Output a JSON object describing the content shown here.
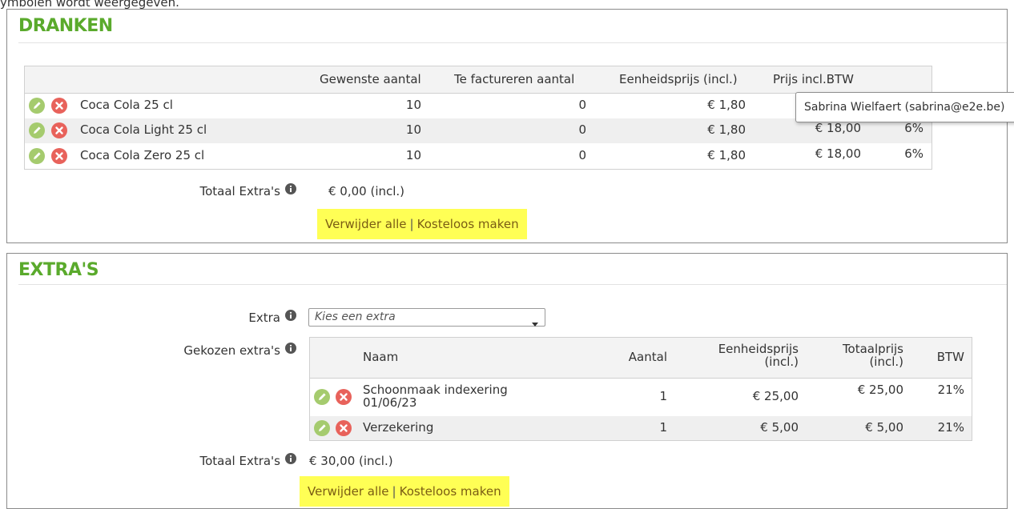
{
  "intro_text": "ymbolen wordt weergegeven.",
  "tooltip_text": "Sabrina Wielfaert (sabrina@e2e.be)",
  "colors": {
    "title_green": "#5aaa2c",
    "edit_icon": "#a5cb6e",
    "delete_icon": "#e8625b",
    "highlight": "#ffff55"
  },
  "icons": {
    "edit": "pencil-icon",
    "delete": "x-circle-icon",
    "info": "info-icon",
    "dropdown": "caret-down-icon"
  },
  "dranken": {
    "title": "DRANKEN",
    "columns": {
      "qty_wanted": "Gewenste aantal",
      "qty_invoice": "Te factureren aantal",
      "unit_price": "Eenheidsprijs (incl.)",
      "price": "Prijs incl.BTW"
    },
    "rows": [
      {
        "name": "Coca Cola 25 cl",
        "qty_wanted": "10",
        "qty_invoice": "0",
        "unit_price": "€ 1,80",
        "price": "",
        "vat": ""
      },
      {
        "name": "Coca Cola Light 25 cl",
        "qty_wanted": "10",
        "qty_invoice": "0",
        "unit_price": "€ 1,80",
        "price": "€ 18,00",
        "vat": "6%"
      },
      {
        "name": "Coca Cola Zero 25 cl",
        "qty_wanted": "10",
        "qty_invoice": "0",
        "unit_price": "€ 1,80",
        "price": "€ 18,00",
        "vat": "6%"
      }
    ],
    "total_label": "Totaal Extra's",
    "total_value": "€ 0,00 (incl.)",
    "remove_all": "Verwijder alle",
    "separator": "|",
    "make_free": "Kosteloos maken"
  },
  "extras": {
    "title": "EXTRA'S",
    "extra_label": "Extra",
    "select_placeholder": "Kies een extra",
    "chosen_label": "Gekozen extra's",
    "columns": {
      "name": "Naam",
      "qty": "Aantal",
      "unit_price_1": "Eenheidsprijs",
      "unit_price_2": "(incl.)",
      "total_1": "Totaalprijs",
      "total_2": "(incl.)",
      "vat": "BTW"
    },
    "rows": [
      {
        "name_1": "Schoonmaak indexering",
        "name_2": "01/06/23",
        "qty": "1",
        "unit_price": "€ 25,00",
        "total": "€ 25,00",
        "vat": "21%"
      },
      {
        "name_1": "Verzekering",
        "name_2": "",
        "qty": "1",
        "unit_price": "€ 5,00",
        "total": "€ 5,00",
        "vat": "21%"
      }
    ],
    "total_label": "Totaal Extra's",
    "total_value": "€ 30,00 (incl.)",
    "remove_all": "Verwijder alle",
    "separator": "|",
    "make_free": "Kosteloos maken"
  }
}
